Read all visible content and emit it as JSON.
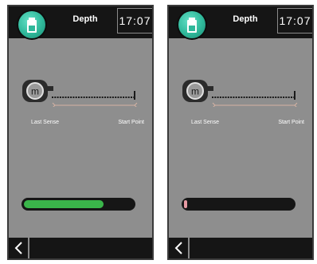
{
  "screens": [
    {
      "title": "Depth",
      "clock": "17:07",
      "labels": {
        "last_sense": "Last Sense",
        "start_point": "Start Point"
      },
      "tape_icon": "m",
      "progress": 0.73,
      "progress_color": "#3ab54a"
    },
    {
      "title": "Depth",
      "clock": "17:07",
      "labels": {
        "last_sense": "Last Sense",
        "start_point": "Start Point"
      },
      "tape_icon": "m",
      "progress": 0.03,
      "progress_color": "#e79aa3"
    }
  ],
  "icons": {
    "logo": "battery-logo-icon",
    "back": "chevron-left-icon",
    "tape": "tape-measure-icon"
  }
}
